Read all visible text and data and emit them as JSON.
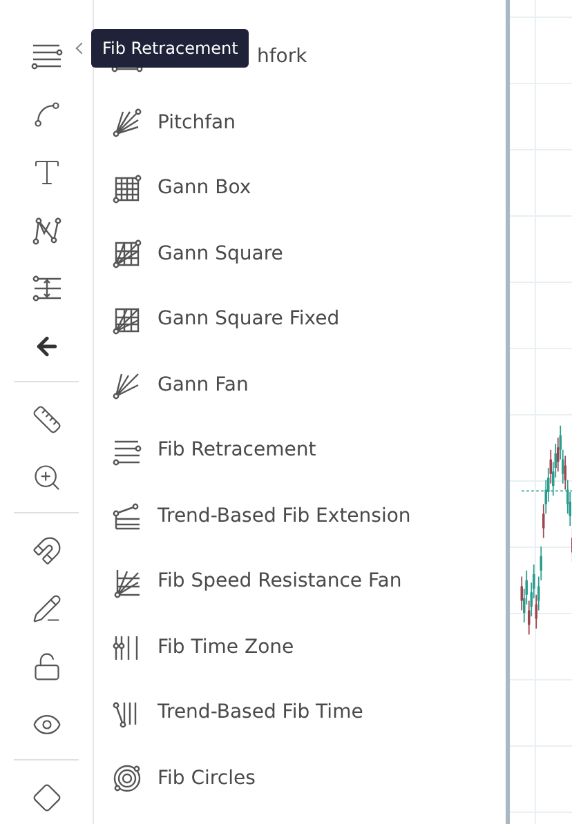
{
  "tooltip": {
    "text": "Fib Retracement"
  },
  "menu": {
    "items": [
      {
        "label": "hfork"
      },
      {
        "label": "Pitchfan"
      },
      {
        "label": "Gann Box"
      },
      {
        "label": "Gann Square"
      },
      {
        "label": "Gann Square Fixed"
      },
      {
        "label": "Gann Fan"
      },
      {
        "label": "Fib Retracement"
      },
      {
        "label": "Trend-Based Fib Extension"
      },
      {
        "label": "Fib Speed Resistance Fan"
      },
      {
        "label": "Fib Time Zone"
      },
      {
        "label": "Trend-Based Fib Time"
      },
      {
        "label": "Fib Circles"
      }
    ]
  }
}
